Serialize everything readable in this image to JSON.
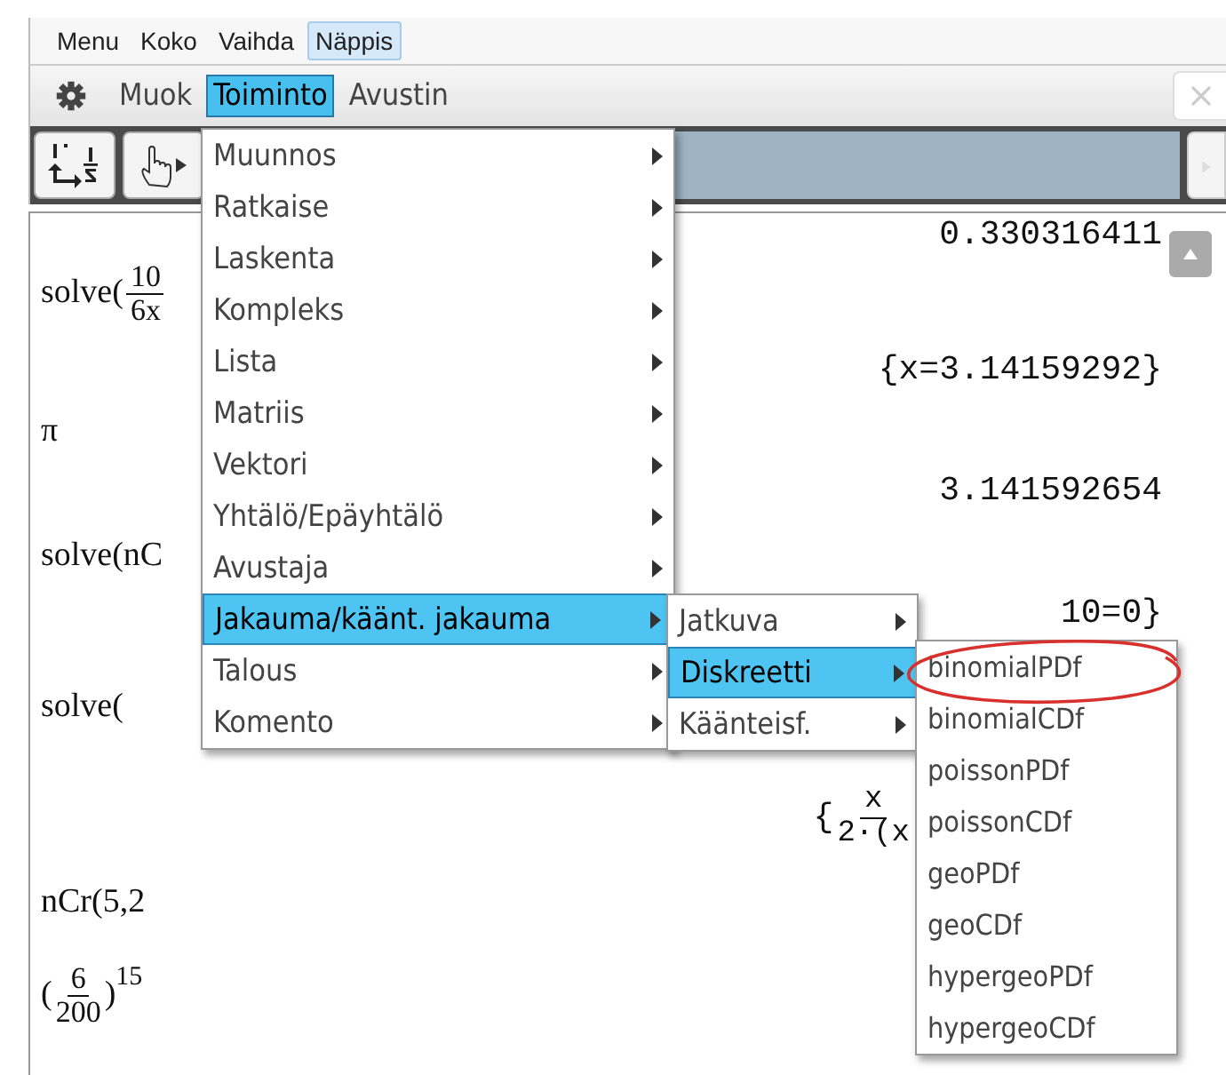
{
  "menubar": [
    {
      "label": "Menu",
      "selected": false
    },
    {
      "label": "Koko",
      "selected": false
    },
    {
      "label": "Vaihda",
      "selected": false
    },
    {
      "label": "Näppis",
      "selected": true
    }
  ],
  "toolbar": [
    {
      "label": "Muok",
      "selected": false
    },
    {
      "label": "Toiminto",
      "selected": true
    },
    {
      "label": "Avustin",
      "selected": false
    }
  ],
  "work_lines": [
    {
      "kind": "output",
      "text": "0.330316411"
    },
    {
      "kind": "input",
      "text": "solve(",
      "fraction": {
        "num": "10",
        "den": "6x"
      }
    },
    {
      "kind": "output",
      "text": "{x=3.14159292}"
    },
    {
      "kind": "input",
      "text": "π"
    },
    {
      "kind": "output",
      "text": "3.141592654"
    },
    {
      "kind": "input",
      "text": "solve(nC"
    },
    {
      "kind": "output",
      "text": "10=0}"
    },
    {
      "kind": "input",
      "text": "solve("
    },
    {
      "kind": "output",
      "text": "{",
      "fraction": {
        "num": "x",
        "den": "2·(x"
      }
    },
    {
      "kind": "input",
      "text": "nCr(5,2"
    },
    {
      "kind": "input",
      "text": "(",
      "fraction": {
        "num": "6",
        "den": "200"
      },
      "after": ")",
      "sup": "15"
    }
  ],
  "menu": [
    {
      "label": "Muunnos",
      "selected": false
    },
    {
      "label": "Ratkaise",
      "selected": false
    },
    {
      "label": "Laskenta",
      "selected": false
    },
    {
      "label": "Kompleks",
      "selected": false
    },
    {
      "label": "Lista",
      "selected": false
    },
    {
      "label": "Matriis",
      "selected": false
    },
    {
      "label": "Vektori",
      "selected": false
    },
    {
      "label": "Yhtälö/Epäyhtälö",
      "selected": false
    },
    {
      "label": "Avustaja",
      "selected": false
    },
    {
      "label": "Jakauma/käänt. jakauma",
      "selected": true
    },
    {
      "label": "Talous",
      "selected": false
    },
    {
      "label": "Komento",
      "selected": false
    }
  ],
  "submenu": [
    {
      "label": "Jatkuva",
      "selected": false
    },
    {
      "label": "Diskreetti",
      "selected": true
    },
    {
      "label": "Käänteisf.",
      "selected": false
    }
  ],
  "subsubmenu": [
    {
      "label": "binomialPDf",
      "circled": true
    },
    {
      "label": "binomialCDf",
      "circled": false
    },
    {
      "label": "poissonPDf",
      "circled": false
    },
    {
      "label": "poissonCDf",
      "circled": false
    },
    {
      "label": "geoPDf",
      "circled": false
    },
    {
      "label": "geoCDf",
      "circled": false
    },
    {
      "label": "hypergeoPDf",
      "circled": false
    },
    {
      "label": "hypergeoCDf",
      "circled": false
    }
  ]
}
